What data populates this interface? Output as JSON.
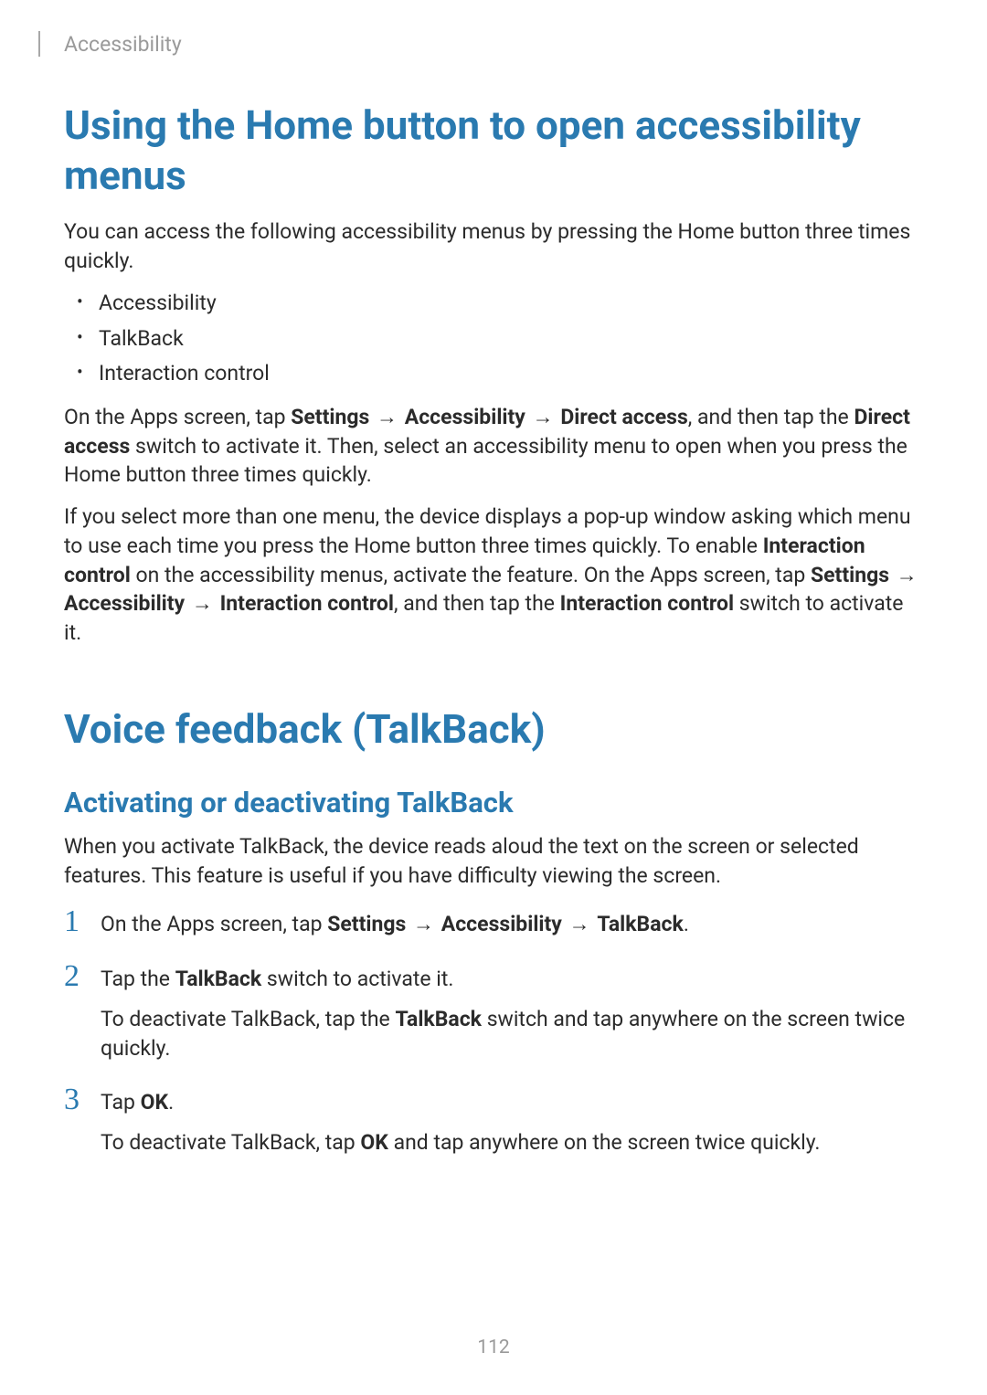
{
  "breadcrumb": "Accessibility",
  "section1": {
    "heading": "Using the Home button to open accessibility menus",
    "intro": "You can access the following accessibility menus by pressing the Home button three times quickly.",
    "bullets": [
      "Accessibility",
      "TalkBack",
      "Interaction control"
    ],
    "para_after_bullets": {
      "prefix": "On the Apps screen, tap ",
      "b1": "Settings",
      "arrow1": "→",
      "b2": "Accessibility",
      "arrow2": "→",
      "b3": "Direct access",
      "mid": ", and then tap the ",
      "b4": "Direct access",
      "suffix": " switch to activate it. Then, select an accessibility menu to open when you press the Home button three times quickly."
    },
    "para2": {
      "t1": "If you select more than one menu, the device displays a pop-up window asking which menu to use each time you press the Home button three times quickly. To enable ",
      "b1": "Interaction control",
      "t2": " on the accessibility menus, activate the feature. On the Apps screen, tap ",
      "b2": "Settings",
      "arrow1": "→",
      "b3": "Accessibility",
      "arrow2": "→",
      "b4": "Interaction control",
      "t3": ", and then tap the ",
      "b5": "Interaction control",
      "t4": " switch to activate it."
    }
  },
  "section2": {
    "heading": "Voice feedback (TalkBack)",
    "subheading": "Activating or deactivating TalkBack",
    "intro": "When you activate TalkBack, the device reads aloud the text on the screen or selected features. This feature is useful if you have difficulty viewing the screen.",
    "steps": [
      {
        "num": "1",
        "prefix": "On the Apps screen, tap ",
        "b1": "Settings",
        "arrow1": "→",
        "b2": "Accessibility",
        "arrow2": "→",
        "b3": "TalkBack",
        "suffix": "."
      },
      {
        "num": "2",
        "prefix": "Tap the ",
        "b1": "TalkBack",
        "suffix": " switch to activate it.",
        "sub_prefix": "To deactivate TalkBack, tap the ",
        "sub_b1": "TalkBack",
        "sub_suffix": " switch and tap anywhere on the screen twice quickly."
      },
      {
        "num": "3",
        "prefix": "Tap ",
        "b1": "OK",
        "suffix": ".",
        "sub_prefix": "To deactivate TalkBack, tap ",
        "sub_b1": "OK",
        "sub_suffix": " and tap anywhere on the screen twice quickly."
      }
    ]
  },
  "page_number": "112"
}
